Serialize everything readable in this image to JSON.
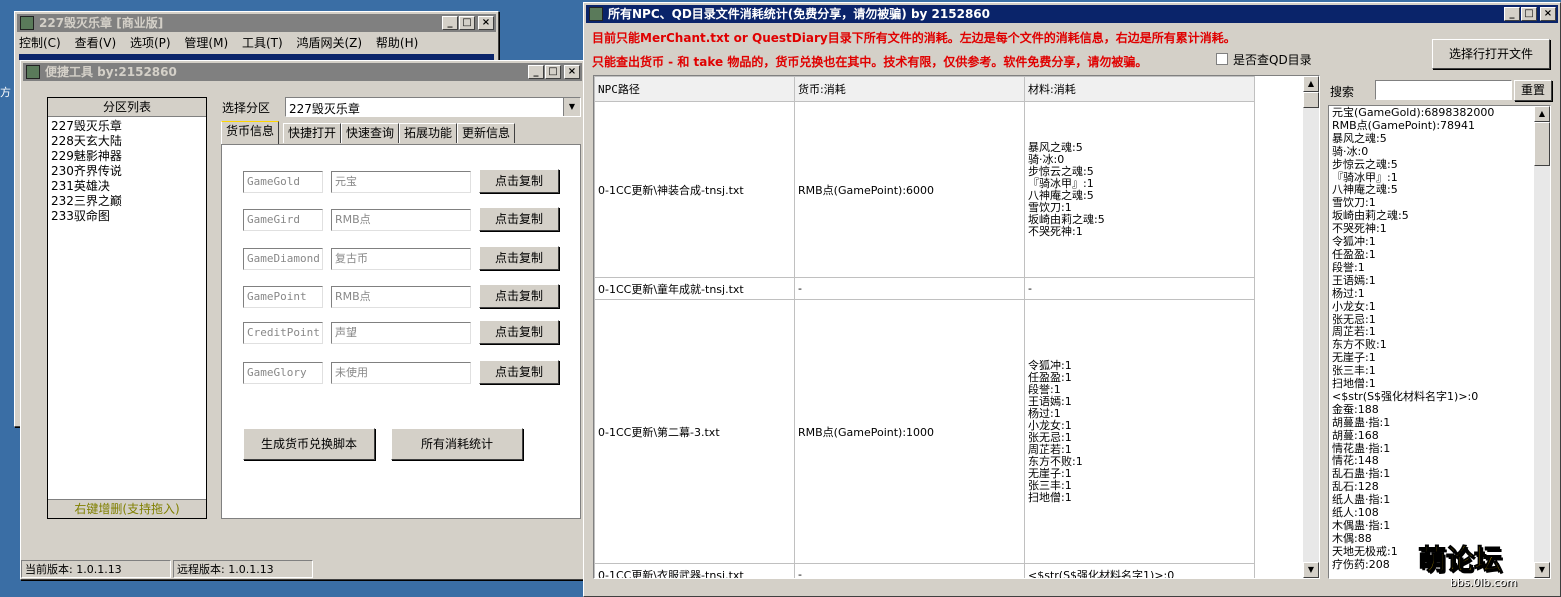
{
  "desktop_edge_text": [
    "方",
    "口",
    "口"
  ],
  "win_back": {
    "title": "227毁灭乐章 [商业版]",
    "menu": [
      "控制(C)",
      "查看(V)",
      "选项(P)",
      "管理(M)",
      "工具(T)",
      "鸿盾网关(Z)",
      "帮助(H)"
    ],
    "buttons": [
      "_",
      "□",
      "×"
    ]
  },
  "win_tool": {
    "title": "便捷工具   by:2152860",
    "partition_list_header": "分区列表",
    "partitions": [
      "227毁灭乐章",
      "228天玄大陆",
      "229魅影神器",
      "230齐界传说",
      "231英雄决",
      "232三界之巅",
      "233驭命图"
    ],
    "partition_footer": "右键增删(支持拖入)",
    "select_label": "选择分区",
    "select_value": "227毁灭乐章",
    "tabs": [
      "货币信息",
      "快捷打开",
      "快速查询",
      "拓展功能",
      "更新信息"
    ],
    "currency_rows": [
      {
        "code": "GameGold",
        "name": "元宝",
        "button": "点击复制"
      },
      {
        "code": "GameGird",
        "name": "RMB点",
        "button": "点击复制"
      },
      {
        "code": "GameDiamond",
        "name": "复古币",
        "button": "点击复制"
      },
      {
        "code": "GamePoint",
        "name": "RMB点",
        "button": "点击复制"
      },
      {
        "code": "CreditPoint",
        "name": "声望",
        "button": "点击复制"
      },
      {
        "code": "GameGlory",
        "name": "未使用",
        "button": "点击复制"
      }
    ],
    "gen_button": "生成货币兑换脚本",
    "stats_button": "所有消耗统计",
    "status_current": "当前版本: 1.0.1.13",
    "status_remote": "远程版本: 1.0.1.13"
  },
  "win_stats": {
    "title": "所有NPC、QD目录文件消耗统计(免费分享，请勿被骗)     by 2152860",
    "info_line1": "目前只能MerChant.txt or QuestDiary目录下所有文件的消耗。左边是每个文件的消耗信息，右边是所有累计消耗。",
    "info_line2": "只能查出货币 - 和 take 物品的，货币兑换也在其中。技术有限，仅供参考。软件免费分享，请勿被骗。",
    "checkbox_label": "是否查QD目录",
    "open_file_button": "选择行打开文件",
    "search_label": "搜索",
    "search_value": "",
    "reset_button": "重置",
    "columns": [
      "NPC路径",
      "货币:消耗",
      "材料:消耗"
    ],
    "rows": [
      {
        "path": "0-1CC更新\\神装合成-tnsj.txt",
        "currency": "RMB点(GamePoint):6000",
        "materials": [
          "暴风之魂:5",
          "骑·冰:0",
          "步惊云之魂:5",
          "『骑冰甲』:1",
          "八神庵之魂:5",
          "雪饮刀:1",
          "坂崎由莉之魂:5",
          "不哭死神:1"
        ]
      },
      {
        "path": "0-1CC更新\\童年成就-tnsj.txt",
        "currency": "-",
        "materials": [
          "-"
        ]
      },
      {
        "path": "0-1CC更新\\第二幕-3.txt",
        "currency": "RMB点(GamePoint):1000",
        "materials": [
          "令狐冲:1",
          "任盈盈:1",
          "段誉:1",
          "王语嫣:1",
          "杨过:1",
          "小龙女:1",
          "张无忌:1",
          "周芷若:1",
          "东方不败:1",
          "无崖子:1",
          "张三丰:1",
          "扫地僧:1"
        ]
      },
      {
        "path": "0-1CC更新\\衣服武器-tnsj.txt",
        "currency": "-",
        "materials": [
          "<$str(S$强化材料名字1)>:0"
        ]
      }
    ],
    "totals": [
      "元宝(GameGold):6898382000",
      "RMB点(GamePoint):78941",
      "暴风之魂:5",
      "骑·冰:0",
      "步惊云之魂:5",
      "『骑冰甲』:1",
      "八神庵之魂:5",
      "雪饮刀:1",
      "坂崎由莉之魂:5",
      "不哭死神:1",
      "令狐冲:1",
      "任盈盈:1",
      "段誉:1",
      "王语嫣:1",
      "杨过:1",
      "小龙女:1",
      "张无忌:1",
      "周芷若:1",
      "东方不败:1",
      "无崖子:1",
      "张三丰:1",
      "扫地僧:1",
      "<$str(S$强化材料名字1)>:0",
      "金蚕:188",
      "胡蔓蛊·指:1",
      "胡蔓:168",
      "情花蛊·指:1",
      "情花:148",
      "乱石蛊·指:1",
      "乱石:128",
      "纸人蛊·指:1",
      "纸人:108",
      "木偶蛊·指:1",
      "木偶:88",
      "天地无极戒:1",
      "疗伤药:208"
    ]
  },
  "watermark": {
    "main": "萌论坛",
    "sub": "bbs.0lb.com"
  }
}
